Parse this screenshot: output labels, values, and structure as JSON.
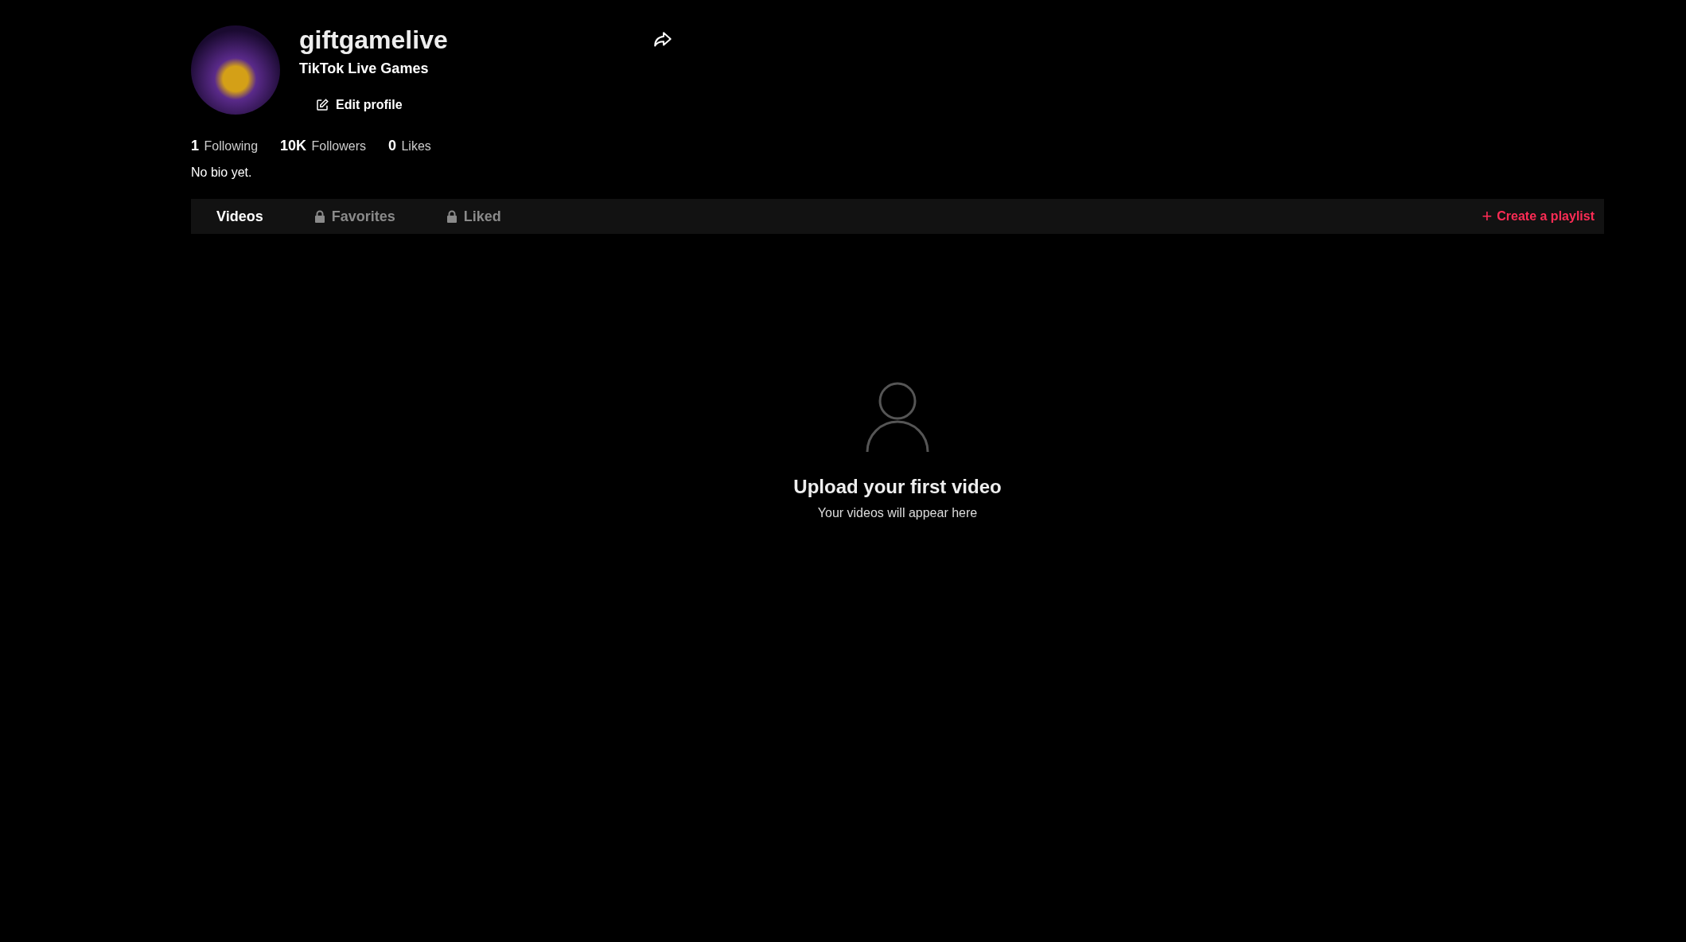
{
  "profile": {
    "username": "giftgamelive",
    "display_name": "TikTok Live Games",
    "edit_button": "Edit profile"
  },
  "stats": [
    "**1** Following",
    "**10K** Followers",
    "**0** Likes"
  ],
  "bio": "No bio yet.",
  "tabs": [
    {
      "label": "Videos",
      "selected": true,
      "locked": false
    },
    {
      "label": "Favorites",
      "selected": false,
      "locked": true
    },
    {
      "label": "Liked",
      "selected": false,
      "locked": true
    }
  ],
  "create_playlist": {
    "icon": "+",
    "label": "Create a playlist"
  },
  "empty_state": {
    "title": "Upload your first video",
    "subtitle": "Your videos will appear here"
  }
}
